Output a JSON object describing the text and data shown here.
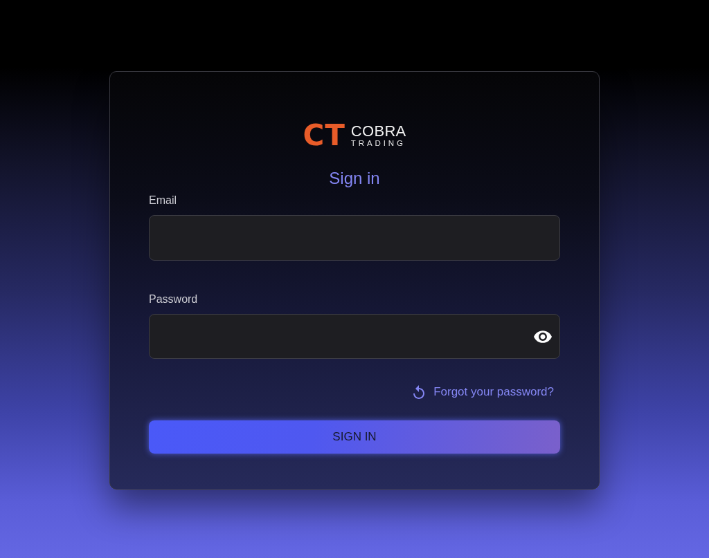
{
  "logo": {
    "mark": "CT",
    "name": "COBRA",
    "tagline": "TRADING"
  },
  "title": "Sign in",
  "fields": [
    {
      "kind": "email",
      "label": "Email"
    },
    {
      "kind": "password",
      "label": "Password"
    }
  ],
  "forgot_link": "Forgot your password?",
  "submit_button": "SIGN IN"
}
